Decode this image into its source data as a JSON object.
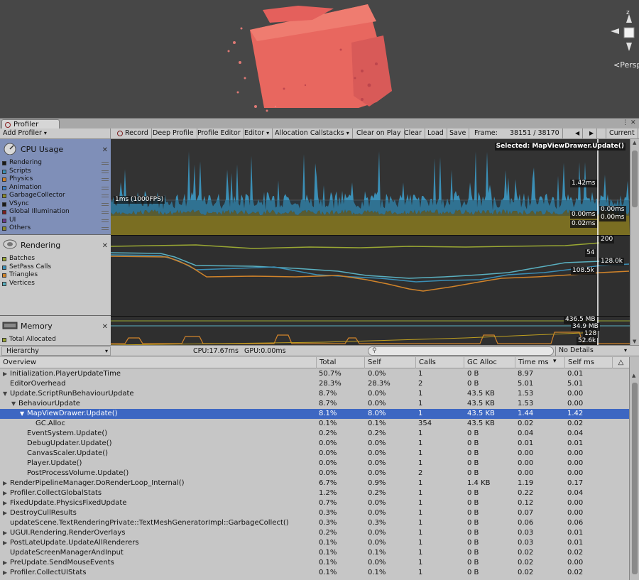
{
  "scene": {
    "persp_label": "<Persp",
    "gizmo_axis": "z"
  },
  "window": {
    "tab_label": "Profiler",
    "menu_icon": "menu-icon",
    "maximize_icon": "maximize-icon",
    "close_icon": "close-icon"
  },
  "toolbar": {
    "add_profiler": "Add Profiler",
    "record": "Record",
    "deep_profile": "Deep Profile",
    "profile_editor": "Profile Editor",
    "editor": "Editor",
    "allocation_callstacks": "Allocation Callstacks",
    "clear_on_play": "Clear on Play",
    "clear": "Clear",
    "load": "Load",
    "save": "Save",
    "frame_label": "Frame:",
    "frame_value": "38151 / 38170",
    "prev_icon": "◀",
    "next_icon": "▶",
    "current": "Current"
  },
  "modules": {
    "cpu": {
      "title": "CPU Usage",
      "legend": [
        {
          "label": "Rendering",
          "color": "#1a1a1a"
        },
        {
          "label": "Scripts",
          "color": "#3b8fb6"
        },
        {
          "label": "Physics",
          "color": "#d0832a"
        },
        {
          "label": "Animation",
          "color": "#3c7fc8"
        },
        {
          "label": "GarbageCollector",
          "color": "#8a8a2a"
        },
        {
          "label": "VSync",
          "color": "#1a1a1a"
        },
        {
          "label": "Global Illumination",
          "color": "#7a1e1e"
        },
        {
          "label": "UI",
          "color": "#6a3a8a"
        },
        {
          "label": "Others",
          "color": "#8a8a2a"
        }
      ],
      "selected_label": "Selected: MapViewDrawer.Update()",
      "line_label": "1ms (1000FPS)",
      "value_labels": [
        "1.42ms",
        "0.00ms",
        "0.00ms",
        "0.00ms",
        "0.02ms"
      ]
    },
    "rendering": {
      "title": "Rendering",
      "legend": [
        {
          "label": "Batches",
          "color": "#9aa833"
        },
        {
          "label": "SetPass Calls",
          "color": "#3b8fb6"
        },
        {
          "label": "Triangles",
          "color": "#d0832a"
        },
        {
          "label": "Vertices",
          "color": "#5ab0c0"
        }
      ],
      "value_labels": [
        "200",
        "54",
        "128.0k",
        "108.5k"
      ]
    },
    "memory": {
      "title": "Memory",
      "legend": [
        {
          "label": "Total Allocated",
          "color": "#9aa833"
        }
      ],
      "value_labels": [
        "436.5 MB",
        "34.9 MB",
        "128",
        "52.6k"
      ]
    }
  },
  "hierarchy_bar": {
    "view_select": "Hierarchy",
    "cpu_stat": "CPU:17.67ms",
    "gpu_stat": "GPU:0.00ms",
    "search_icon": "search-icon",
    "details_select": "No Details"
  },
  "table": {
    "columns": [
      "Overview",
      "Total",
      "Self",
      "Calls",
      "GC Alloc",
      "Time ms",
      "Self ms",
      "△"
    ],
    "sort_indicator": "▾",
    "rows": [
      {
        "name": "Initialization.PlayerUpdateTime",
        "indent": 0,
        "expander": "▶",
        "total": "50.7%",
        "self": "0.0%",
        "calls": "1",
        "gc": "0 B",
        "time": "8.97",
        "selfms": "0.01"
      },
      {
        "name": "EditorOverhead",
        "indent": 0,
        "expander": "",
        "total": "28.3%",
        "self": "28.3%",
        "calls": "2",
        "gc": "0 B",
        "time": "5.01",
        "selfms": "5.01"
      },
      {
        "name": "Update.ScriptRunBehaviourUpdate",
        "indent": 0,
        "expander": "▼",
        "total": "8.7%",
        "self": "0.0%",
        "calls": "1",
        "gc": "43.5 KB",
        "time": "1.53",
        "selfms": "0.00"
      },
      {
        "name": "BehaviourUpdate",
        "indent": 1,
        "expander": "▼",
        "total": "8.7%",
        "self": "0.0%",
        "calls": "1",
        "gc": "43.5 KB",
        "time": "1.53",
        "selfms": "0.00"
      },
      {
        "name": "MapViewDrawer.Update()",
        "indent": 2,
        "expander": "▼",
        "total": "8.1%",
        "self": "8.0%",
        "calls": "1",
        "gc": "43.5 KB",
        "time": "1.44",
        "selfms": "1.42",
        "selected": true
      },
      {
        "name": "GC.Alloc",
        "indent": 3,
        "expander": "",
        "total": "0.1%",
        "self": "0.1%",
        "calls": "354",
        "gc": "43.5 KB",
        "time": "0.02",
        "selfms": "0.02"
      },
      {
        "name": "EventSystem.Update()",
        "indent": 2,
        "expander": "",
        "total": "0.2%",
        "self": "0.2%",
        "calls": "1",
        "gc": "0 B",
        "time": "0.04",
        "selfms": "0.04"
      },
      {
        "name": "DebugUpdater.Update()",
        "indent": 2,
        "expander": "",
        "total": "0.0%",
        "self": "0.0%",
        "calls": "1",
        "gc": "0 B",
        "time": "0.01",
        "selfms": "0.01"
      },
      {
        "name": "CanvasScaler.Update()",
        "indent": 2,
        "expander": "",
        "total": "0.0%",
        "self": "0.0%",
        "calls": "1",
        "gc": "0 B",
        "time": "0.00",
        "selfms": "0.00"
      },
      {
        "name": "Player.Update()",
        "indent": 2,
        "expander": "",
        "total": "0.0%",
        "self": "0.0%",
        "calls": "1",
        "gc": "0 B",
        "time": "0.00",
        "selfms": "0.00"
      },
      {
        "name": "PostProcessVolume.Update()",
        "indent": 2,
        "expander": "",
        "total": "0.0%",
        "self": "0.0%",
        "calls": "2",
        "gc": "0 B",
        "time": "0.00",
        "selfms": "0.00"
      },
      {
        "name": "RenderPipelineManager.DoRenderLoop_Internal()",
        "indent": 0,
        "expander": "▶",
        "total": "6.7%",
        "self": "0.9%",
        "calls": "1",
        "gc": "1.4 KB",
        "time": "1.19",
        "selfms": "0.17"
      },
      {
        "name": "Profiler.CollectGlobalStats",
        "indent": 0,
        "expander": "▶",
        "total": "1.2%",
        "self": "0.2%",
        "calls": "1",
        "gc": "0 B",
        "time": "0.22",
        "selfms": "0.04"
      },
      {
        "name": "FixedUpdate.PhysicsFixedUpdate",
        "indent": 0,
        "expander": "▶",
        "total": "0.7%",
        "self": "0.0%",
        "calls": "1",
        "gc": "0 B",
        "time": "0.12",
        "selfms": "0.00"
      },
      {
        "name": "DestroyCullResults",
        "indent": 0,
        "expander": "▶",
        "total": "0.3%",
        "self": "0.0%",
        "calls": "1",
        "gc": "0 B",
        "time": "0.07",
        "selfms": "0.00"
      },
      {
        "name": "updateScene.TextRenderingPrivate::TextMeshGeneratorImpl::GarbageCollect()",
        "indent": 0,
        "expander": "",
        "total": "0.3%",
        "self": "0.3%",
        "calls": "1",
        "gc": "0 B",
        "time": "0.06",
        "selfms": "0.06"
      },
      {
        "name": "UGUI.Rendering.RenderOverlays",
        "indent": 0,
        "expander": "▶",
        "total": "0.2%",
        "self": "0.0%",
        "calls": "1",
        "gc": "0 B",
        "time": "0.03",
        "selfms": "0.01"
      },
      {
        "name": "PostLateUpdate.UpdateAllRenderers",
        "indent": 0,
        "expander": "▶",
        "total": "0.1%",
        "self": "0.0%",
        "calls": "1",
        "gc": "0 B",
        "time": "0.03",
        "selfms": "0.01"
      },
      {
        "name": "UpdateScreenManagerAndInput",
        "indent": 0,
        "expander": "",
        "total": "0.1%",
        "self": "0.1%",
        "calls": "1",
        "gc": "0 B",
        "time": "0.02",
        "selfms": "0.02"
      },
      {
        "name": "PreUpdate.SendMouseEvents",
        "indent": 0,
        "expander": "▶",
        "total": "0.1%",
        "self": "0.0%",
        "calls": "1",
        "gc": "0 B",
        "time": "0.02",
        "selfms": "0.00"
      },
      {
        "name": "Profiler.CollectUIStats",
        "indent": 0,
        "expander": "▶",
        "total": "0.1%",
        "self": "0.1%",
        "calls": "1",
        "gc": "0 B",
        "time": "0.02",
        "selfms": "0.02"
      }
    ]
  }
}
